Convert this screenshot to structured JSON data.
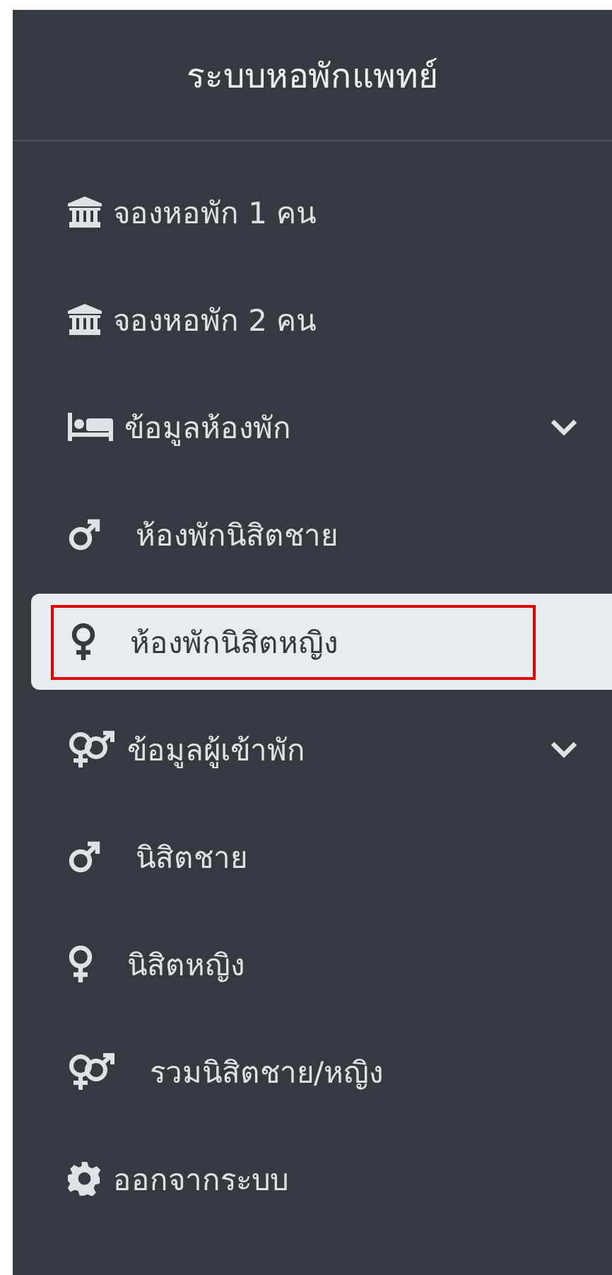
{
  "sidebar": {
    "title": "ระบบหอพักแพทย์",
    "items": [
      {
        "kind": "bank",
        "label": "จองหอพัก 1 คน",
        "selected": false,
        "annotated": false,
        "submenu": false
      },
      {
        "kind": "bank",
        "label": "จองหอพัก 2 คน",
        "selected": false,
        "annotated": false,
        "submenu": false
      },
      {
        "kind": "bed",
        "label": "ข้อมูลห้องพัก",
        "selected": false,
        "annotated": false,
        "submenu": true,
        "children": [
          {
            "kind": "male",
            "label": "ห้องพักนิสิตชาย",
            "selected": false,
            "annotated": false,
            "submenu": false
          },
          {
            "kind": "female",
            "label": "ห้องพักนิสิตหญิง",
            "selected": true,
            "annotated": true,
            "submenu": false
          }
        ]
      },
      {
        "kind": "both",
        "label": "ข้อมูลผู้เข้าพัก",
        "selected": false,
        "annotated": false,
        "submenu": true,
        "children": [
          {
            "kind": "male",
            "label": "นิสิตชาย",
            "selected": false,
            "annotated": false,
            "submenu": false
          },
          {
            "kind": "female",
            "label": "นิสิตหญิง",
            "selected": false,
            "annotated": false,
            "submenu": false
          },
          {
            "kind": "both",
            "label": "รวมนิสิตชาย/หญิง",
            "selected": false,
            "annotated": false,
            "submenu": false
          }
        ]
      },
      {
        "kind": "gear",
        "label": "ออกจากระบบ",
        "selected": false,
        "annotated": false,
        "submenu": false
      }
    ]
  }
}
